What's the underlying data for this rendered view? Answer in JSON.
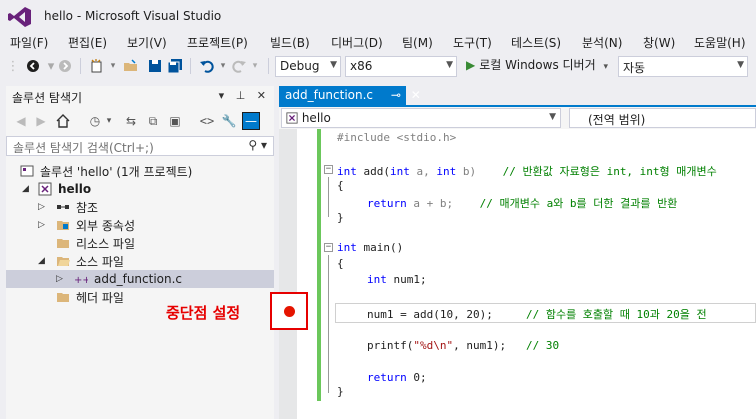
{
  "window": {
    "title": "hello - Microsoft Visual Studio"
  },
  "menu": [
    "파일(F)",
    "편집(E)",
    "보기(V)",
    "프로젝트(P)",
    "빌드(B)",
    "디버그(D)",
    "팀(M)",
    "도구(T)",
    "테스트(S)",
    "분석(N)",
    "창(W)",
    "도움말(H)"
  ],
  "toolbar": {
    "config": "Debug",
    "platform": "x86",
    "run_label": "로컬 Windows 디버거",
    "run_mode": "자동"
  },
  "solution_explorer": {
    "title": "솔루션 탐색기",
    "search_placeholder": "솔루션 탐색기 검색(Ctrl+;)",
    "tree": {
      "solution": "솔루션 'hello' (1개 프로젝트)",
      "project": "hello",
      "references": "참조",
      "external_deps": "외부 종속성",
      "resource_files": "리소스 파일",
      "source_files": "소스 파일",
      "source_file": "add_function.c",
      "header_files": "헤더 파일"
    }
  },
  "editor": {
    "tab_label": "add_function.c",
    "tab_pin": "⊸",
    "tab_close": "✕",
    "nav_scope": "hello",
    "nav_member": "(전역 범위)",
    "lines": {
      "l1": "#include <stdio.h>",
      "l2_kw1": "int",
      "l2_name": " add(",
      "l2_kw2": "int",
      "l2_a": " a, ",
      "l2_kw3": "int",
      "l2_b": " b)",
      "l2_cm": "    // 반환값 자료형은 int, int형 매개변수",
      "l3": "{",
      "l4_kw": "return",
      "l4_rest": " a + b;",
      "l4_cm": "    // 매개변수 a와 b를 더한 결과를 반환",
      "l5": "}",
      "l6_kw": "int",
      "l6_rest": " main()",
      "l7": "{",
      "l8_kw": "int",
      "l8_rest": " num1;",
      "l9_rest": "num1 = add(10, 20);",
      "l9_cm": "     // 함수를 호출할 때 10과 20을 전",
      "l10_a": "printf(",
      "l10_str": "\"%d\\n\"",
      "l10_b": ", num1);",
      "l10_cm": "   // 30",
      "l11_kw": "return",
      "l11_rest": " 0;",
      "l12": "}"
    }
  },
  "annotation": {
    "breakpoint_label": "중단점 설정"
  },
  "colors": {
    "accent": "#007acc",
    "breakpoint": "#e51400",
    "annotation": "#e60000"
  }
}
